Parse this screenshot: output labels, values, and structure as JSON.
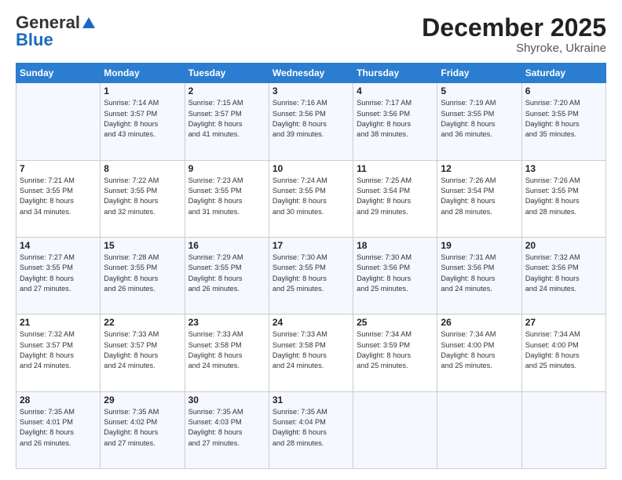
{
  "logo": {
    "general": "General",
    "blue": "Blue"
  },
  "title": "December 2025",
  "subtitle": "Shyroke, Ukraine",
  "days_header": [
    "Sunday",
    "Monday",
    "Tuesday",
    "Wednesday",
    "Thursday",
    "Friday",
    "Saturday"
  ],
  "weeks": [
    [
      {
        "day": "",
        "info": ""
      },
      {
        "day": "1",
        "info": "Sunrise: 7:14 AM\nSunset: 3:57 PM\nDaylight: 8 hours\nand 43 minutes."
      },
      {
        "day": "2",
        "info": "Sunrise: 7:15 AM\nSunset: 3:57 PM\nDaylight: 8 hours\nand 41 minutes."
      },
      {
        "day": "3",
        "info": "Sunrise: 7:16 AM\nSunset: 3:56 PM\nDaylight: 8 hours\nand 39 minutes."
      },
      {
        "day": "4",
        "info": "Sunrise: 7:17 AM\nSunset: 3:56 PM\nDaylight: 8 hours\nand 38 minutes."
      },
      {
        "day": "5",
        "info": "Sunrise: 7:19 AM\nSunset: 3:55 PM\nDaylight: 8 hours\nand 36 minutes."
      },
      {
        "day": "6",
        "info": "Sunrise: 7:20 AM\nSunset: 3:55 PM\nDaylight: 8 hours\nand 35 minutes."
      }
    ],
    [
      {
        "day": "7",
        "info": "Sunrise: 7:21 AM\nSunset: 3:55 PM\nDaylight: 8 hours\nand 34 minutes."
      },
      {
        "day": "8",
        "info": "Sunrise: 7:22 AM\nSunset: 3:55 PM\nDaylight: 8 hours\nand 32 minutes."
      },
      {
        "day": "9",
        "info": "Sunrise: 7:23 AM\nSunset: 3:55 PM\nDaylight: 8 hours\nand 31 minutes."
      },
      {
        "day": "10",
        "info": "Sunrise: 7:24 AM\nSunset: 3:55 PM\nDaylight: 8 hours\nand 30 minutes."
      },
      {
        "day": "11",
        "info": "Sunrise: 7:25 AM\nSunset: 3:54 PM\nDaylight: 8 hours\nand 29 minutes."
      },
      {
        "day": "12",
        "info": "Sunrise: 7:26 AM\nSunset: 3:54 PM\nDaylight: 8 hours\nand 28 minutes."
      },
      {
        "day": "13",
        "info": "Sunrise: 7:26 AM\nSunset: 3:55 PM\nDaylight: 8 hours\nand 28 minutes."
      }
    ],
    [
      {
        "day": "14",
        "info": "Sunrise: 7:27 AM\nSunset: 3:55 PM\nDaylight: 8 hours\nand 27 minutes."
      },
      {
        "day": "15",
        "info": "Sunrise: 7:28 AM\nSunset: 3:55 PM\nDaylight: 8 hours\nand 26 minutes."
      },
      {
        "day": "16",
        "info": "Sunrise: 7:29 AM\nSunset: 3:55 PM\nDaylight: 8 hours\nand 26 minutes."
      },
      {
        "day": "17",
        "info": "Sunrise: 7:30 AM\nSunset: 3:55 PM\nDaylight: 8 hours\nand 25 minutes."
      },
      {
        "day": "18",
        "info": "Sunrise: 7:30 AM\nSunset: 3:56 PM\nDaylight: 8 hours\nand 25 minutes."
      },
      {
        "day": "19",
        "info": "Sunrise: 7:31 AM\nSunset: 3:56 PM\nDaylight: 8 hours\nand 24 minutes."
      },
      {
        "day": "20",
        "info": "Sunrise: 7:32 AM\nSunset: 3:56 PM\nDaylight: 8 hours\nand 24 minutes."
      }
    ],
    [
      {
        "day": "21",
        "info": "Sunrise: 7:32 AM\nSunset: 3:57 PM\nDaylight: 8 hours\nand 24 minutes."
      },
      {
        "day": "22",
        "info": "Sunrise: 7:33 AM\nSunset: 3:57 PM\nDaylight: 8 hours\nand 24 minutes."
      },
      {
        "day": "23",
        "info": "Sunrise: 7:33 AM\nSunset: 3:58 PM\nDaylight: 8 hours\nand 24 minutes."
      },
      {
        "day": "24",
        "info": "Sunrise: 7:33 AM\nSunset: 3:58 PM\nDaylight: 8 hours\nand 24 minutes."
      },
      {
        "day": "25",
        "info": "Sunrise: 7:34 AM\nSunset: 3:59 PM\nDaylight: 8 hours\nand 25 minutes."
      },
      {
        "day": "26",
        "info": "Sunrise: 7:34 AM\nSunset: 4:00 PM\nDaylight: 8 hours\nand 25 minutes."
      },
      {
        "day": "27",
        "info": "Sunrise: 7:34 AM\nSunset: 4:00 PM\nDaylight: 8 hours\nand 25 minutes."
      }
    ],
    [
      {
        "day": "28",
        "info": "Sunrise: 7:35 AM\nSunset: 4:01 PM\nDaylight: 8 hours\nand 26 minutes."
      },
      {
        "day": "29",
        "info": "Sunrise: 7:35 AM\nSunset: 4:02 PM\nDaylight: 8 hours\nand 27 minutes."
      },
      {
        "day": "30",
        "info": "Sunrise: 7:35 AM\nSunset: 4:03 PM\nDaylight: 8 hours\nand 27 minutes."
      },
      {
        "day": "31",
        "info": "Sunrise: 7:35 AM\nSunset: 4:04 PM\nDaylight: 8 hours\nand 28 minutes."
      },
      {
        "day": "",
        "info": ""
      },
      {
        "day": "",
        "info": ""
      },
      {
        "day": "",
        "info": ""
      }
    ]
  ]
}
